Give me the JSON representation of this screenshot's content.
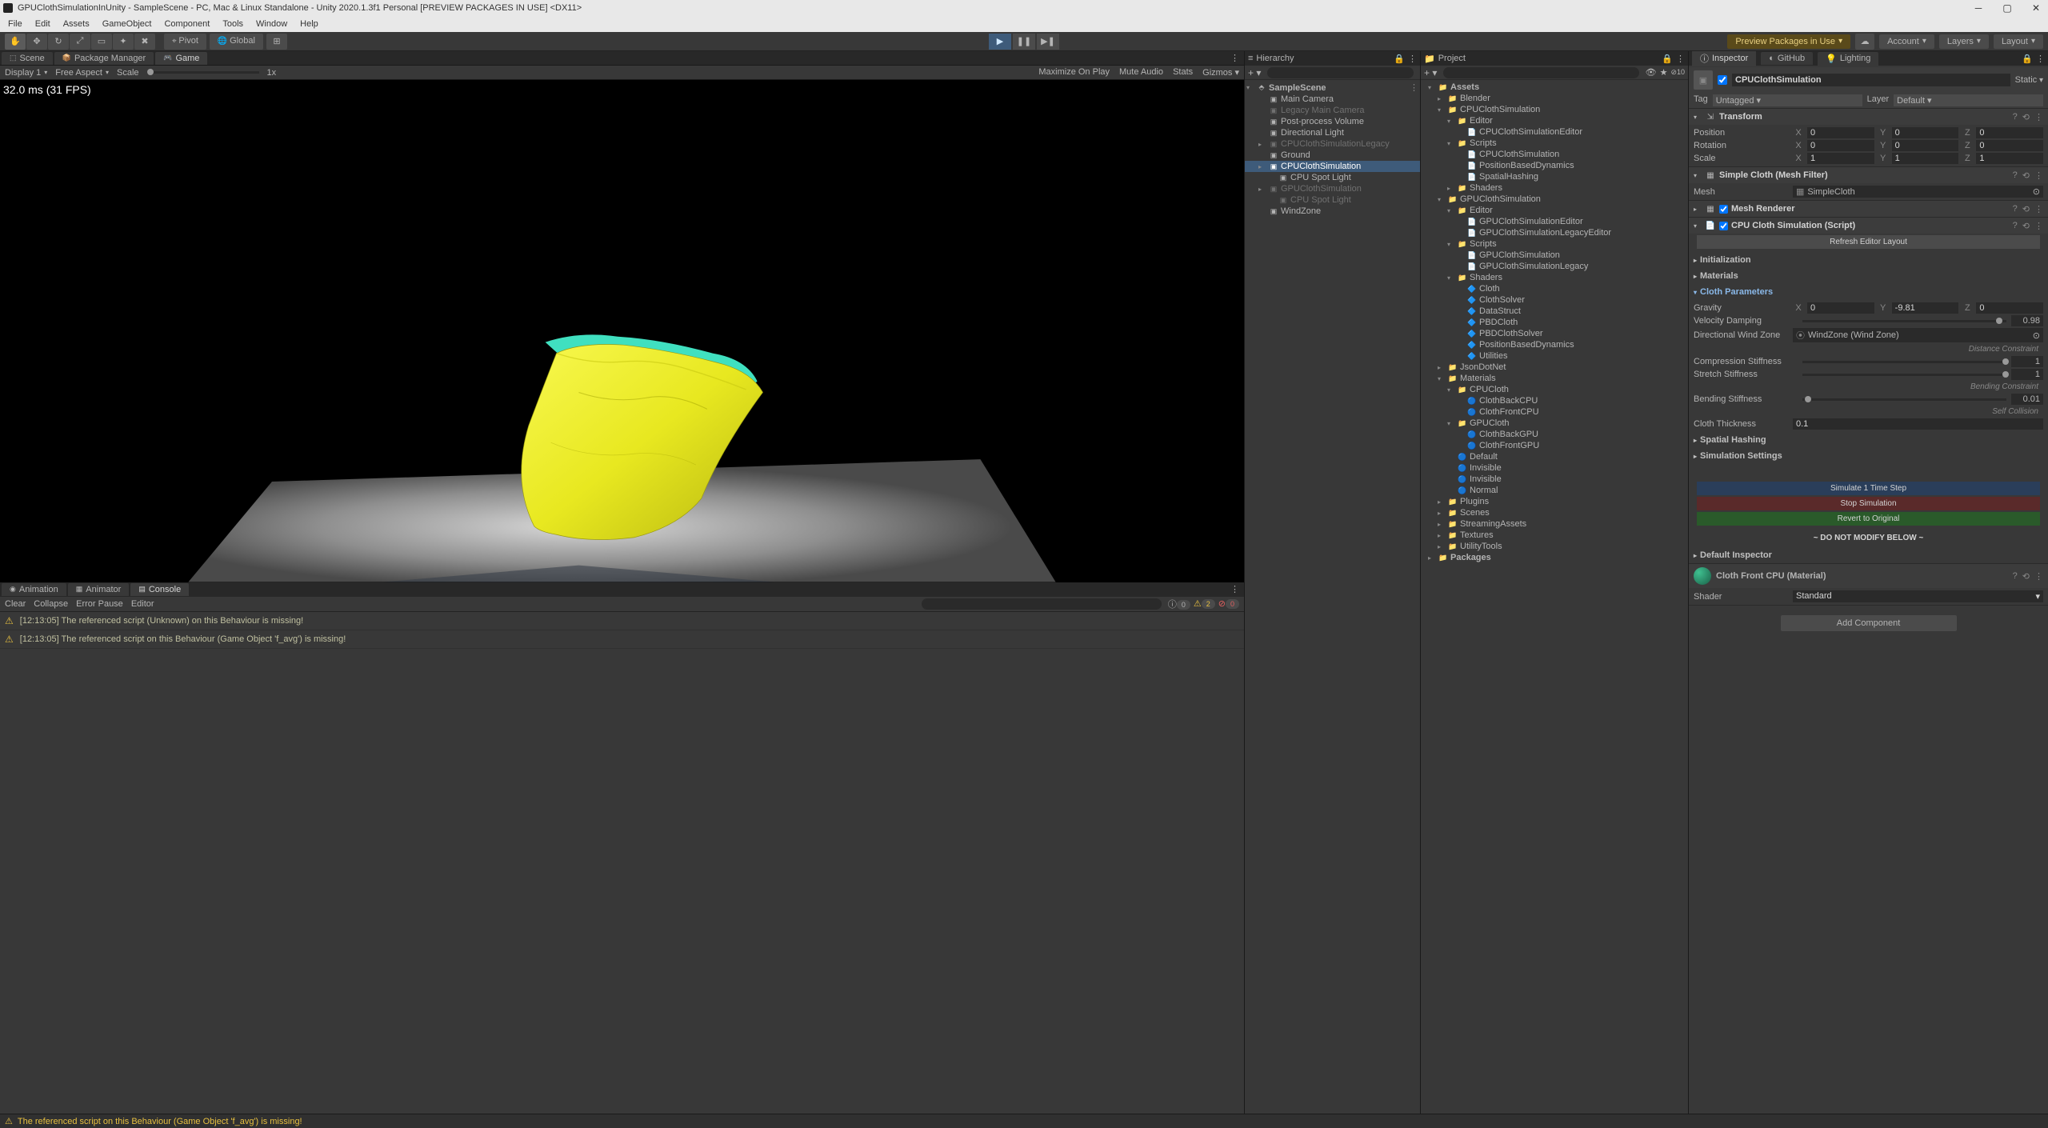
{
  "title": "GPUClothSimulationInUnity - SampleScene - PC, Mac & Linux Standalone - Unity 2020.1.3f1 Personal [PREVIEW PACKAGES IN USE] <DX11>",
  "menu": [
    "File",
    "Edit",
    "Assets",
    "GameObject",
    "Component",
    "Tools",
    "Window",
    "Help"
  ],
  "toolbar": {
    "pivot": "Pivot",
    "global": "Global",
    "preview_packages": "Preview Packages in Use",
    "account": "Account",
    "layers": "Layers",
    "layout": "Layout"
  },
  "left_tabs": {
    "scene": "Scene",
    "pkg": "Package Manager",
    "game": "Game"
  },
  "game_bar": {
    "display": "Display 1",
    "aspect": "Free Aspect",
    "scale": "Scale",
    "scale_val": "1x",
    "max": "Maximize On Play",
    "mute": "Mute Audio",
    "stats": "Stats",
    "gizmos": "Gizmos"
  },
  "viewport": {
    "stats": "32.0 ms (31 FPS)"
  },
  "bottom_tabs": {
    "anim": "Animation",
    "animator": "Animator",
    "console": "Console"
  },
  "console_bar": {
    "clear": "Clear",
    "collapse": "Collapse",
    "ep": "Error Pause",
    "editor": "Editor",
    "c_info": "0",
    "c_warn": "2",
    "c_err": "0"
  },
  "console_rows": [
    "[12:13:05] The referenced script (Unknown) on this Behaviour is missing!",
    "[12:13:05] The referenced script on this Behaviour (Game Object 'f_avg') is missing!"
  ],
  "status": "The referenced script on this Behaviour (Game Object 'f_avg') is missing!",
  "hierarchy": {
    "title": "Hierarchy",
    "scene": "SampleScene",
    "items": [
      {
        "name": "Main Camera"
      },
      {
        "name": "Legacy Main Camera",
        "dim": true
      },
      {
        "name": "Post-process Volume"
      },
      {
        "name": "Directional Light"
      },
      {
        "name": "CPUClothSimulationLegacy",
        "dim": true,
        "foldable": true
      },
      {
        "name": "Ground"
      },
      {
        "name": "CPUClothSimulation",
        "selected": true,
        "foldable": true
      },
      {
        "name": "CPU Spot Light",
        "indent": 1
      },
      {
        "name": "GPUClothSimulation",
        "dim": true,
        "foldable": true
      },
      {
        "name": "CPU Spot Light",
        "dim": true,
        "indent": 1
      },
      {
        "name": "WindZone"
      }
    ]
  },
  "project": {
    "title": "Project",
    "tree": [
      {
        "d": 0,
        "fold": "▾",
        "ico": "📁",
        "name": "Assets",
        "bold": true
      },
      {
        "d": 1,
        "fold": "▸",
        "ico": "📁",
        "name": "Blender"
      },
      {
        "d": 1,
        "fold": "▾",
        "ico": "📁",
        "name": "CPUClothSimulation"
      },
      {
        "d": 2,
        "fold": "▾",
        "ico": "📁",
        "name": "Editor"
      },
      {
        "d": 3,
        "fold": "",
        "ico": "📄",
        "name": "CPUClothSimulationEditor"
      },
      {
        "d": 2,
        "fold": "▾",
        "ico": "📁",
        "name": "Scripts"
      },
      {
        "d": 3,
        "fold": "",
        "ico": "📄",
        "name": "CPUClothSimulation"
      },
      {
        "d": 3,
        "fold": "",
        "ico": "📄",
        "name": "PositionBasedDynamics"
      },
      {
        "d": 3,
        "fold": "",
        "ico": "📄",
        "name": "SpatialHashing"
      },
      {
        "d": 2,
        "fold": "▸",
        "ico": "📁",
        "name": "Shaders"
      },
      {
        "d": 1,
        "fold": "▾",
        "ico": "📁",
        "name": "GPUClothSimulation"
      },
      {
        "d": 2,
        "fold": "▾",
        "ico": "📁",
        "name": "Editor"
      },
      {
        "d": 3,
        "fold": "",
        "ico": "📄",
        "name": "GPUClothSimulationEditor"
      },
      {
        "d": 3,
        "fold": "",
        "ico": "📄",
        "name": "GPUClothSimulationLegacyEditor"
      },
      {
        "d": 2,
        "fold": "▾",
        "ico": "📁",
        "name": "Scripts"
      },
      {
        "d": 3,
        "fold": "",
        "ico": "📄",
        "name": "GPUClothSimulation"
      },
      {
        "d": 3,
        "fold": "",
        "ico": "📄",
        "name": "GPUClothSimulationLegacy"
      },
      {
        "d": 2,
        "fold": "▾",
        "ico": "📁",
        "name": "Shaders"
      },
      {
        "d": 3,
        "fold": "",
        "ico": "🔷",
        "name": "Cloth"
      },
      {
        "d": 3,
        "fold": "",
        "ico": "🔷",
        "name": "ClothSolver"
      },
      {
        "d": 3,
        "fold": "",
        "ico": "🔷",
        "name": "DataStruct"
      },
      {
        "d": 3,
        "fold": "",
        "ico": "🔷",
        "name": "PBDCloth"
      },
      {
        "d": 3,
        "fold": "",
        "ico": "🔷",
        "name": "PBDClothSolver"
      },
      {
        "d": 3,
        "fold": "",
        "ico": "🔷",
        "name": "PositionBasedDynamics"
      },
      {
        "d": 3,
        "fold": "",
        "ico": "🔷",
        "name": "Utilities"
      },
      {
        "d": 1,
        "fold": "▸",
        "ico": "📁",
        "name": "JsonDotNet"
      },
      {
        "d": 1,
        "fold": "▾",
        "ico": "📁",
        "name": "Materials"
      },
      {
        "d": 2,
        "fold": "▾",
        "ico": "📁",
        "name": "CPUCloth"
      },
      {
        "d": 3,
        "fold": "",
        "ico": "🔵",
        "name": "ClothBackCPU"
      },
      {
        "d": 3,
        "fold": "",
        "ico": "🔵",
        "name": "ClothFrontCPU"
      },
      {
        "d": 2,
        "fold": "▾",
        "ico": "📁",
        "name": "GPUCloth"
      },
      {
        "d": 3,
        "fold": "",
        "ico": "🔵",
        "name": "ClothBackGPU"
      },
      {
        "d": 3,
        "fold": "",
        "ico": "🔵",
        "name": "ClothFrontGPU"
      },
      {
        "d": 2,
        "fold": "",
        "ico": "🔵",
        "name": "Default"
      },
      {
        "d": 2,
        "fold": "",
        "ico": "🔵",
        "name": "Invisible"
      },
      {
        "d": 2,
        "fold": "",
        "ico": "🔵",
        "name": "Invisible"
      },
      {
        "d": 2,
        "fold": "",
        "ico": "🔵",
        "name": "Normal"
      },
      {
        "d": 1,
        "fold": "▸",
        "ico": "📁",
        "name": "Plugins"
      },
      {
        "d": 1,
        "fold": "▸",
        "ico": "📁",
        "name": "Scenes"
      },
      {
        "d": 1,
        "fold": "▸",
        "ico": "📁",
        "name": "StreamingAssets"
      },
      {
        "d": 1,
        "fold": "▸",
        "ico": "📁",
        "name": "Textures"
      },
      {
        "d": 1,
        "fold": "▸",
        "ico": "📁",
        "name": "UtilityTools"
      },
      {
        "d": 0,
        "fold": "▸",
        "ico": "📁",
        "name": "Packages",
        "bold": true
      }
    ]
  },
  "inspector": {
    "title": "Inspector",
    "github": "GitHub",
    "lighting": "Lighting",
    "obj_name": "CPUClothSimulation",
    "static": "Static",
    "tag_lbl": "Tag",
    "tag_val": "Untagged",
    "layer_lbl": "Layer",
    "layer_val": "Default",
    "transform": {
      "title": "Transform",
      "pos": {
        "label": "Position",
        "x": "0",
        "y": "0",
        "z": "0"
      },
      "rot": {
        "label": "Rotation",
        "x": "0",
        "y": "0",
        "z": "0"
      },
      "scl": {
        "label": "Scale",
        "x": "1",
        "y": "1",
        "z": "1"
      }
    },
    "meshfilter": {
      "title": "Simple Cloth (Mesh Filter)",
      "mesh_lbl": "Mesh",
      "mesh_val": "SimpleCloth"
    },
    "meshrenderer": {
      "title": "Mesh Renderer"
    },
    "script": {
      "title": "CPU Cloth Simulation (Script)",
      "refresh": "Refresh Editor Layout",
      "sec_init": "Initialization",
      "sec_mat": "Materials",
      "sec_params": "Cloth Parameters",
      "gravity": {
        "label": "Gravity",
        "x": "0",
        "y": "-9.81",
        "z": "0"
      },
      "vdamp": {
        "label": "Velocity Damping",
        "val": "0.98"
      },
      "wind": {
        "label": "Directional Wind Zone",
        "val": "WindZone (Wind Zone)"
      },
      "dist_hdr": "Distance Constraint",
      "comp": {
        "label": "Compression Stiffness",
        "val": "1"
      },
      "stretch": {
        "label": "Stretch Stiffness",
        "val": "1"
      },
      "bend_hdr": "Bending Constraint",
      "bend": {
        "label": "Bending Stiffness",
        "val": "0.01"
      },
      "self_hdr": "Self Collision",
      "thick": {
        "label": "Cloth Thickness",
        "val": "0.1"
      },
      "sec_spatial": "Spatial Hashing",
      "sec_sim": "Simulation Settings",
      "btn1": "Simulate 1 Time Step",
      "btn2": "Stop Simulation",
      "btn3": "Revert to Original",
      "donot": "~ DO NOT MODIFY BELOW ~",
      "def_insp": "Default Inspector"
    },
    "material": {
      "title": "Cloth Front CPU (Material)",
      "shader_lbl": "Shader",
      "shader_val": "Standard"
    },
    "add_comp": "Add Component"
  }
}
